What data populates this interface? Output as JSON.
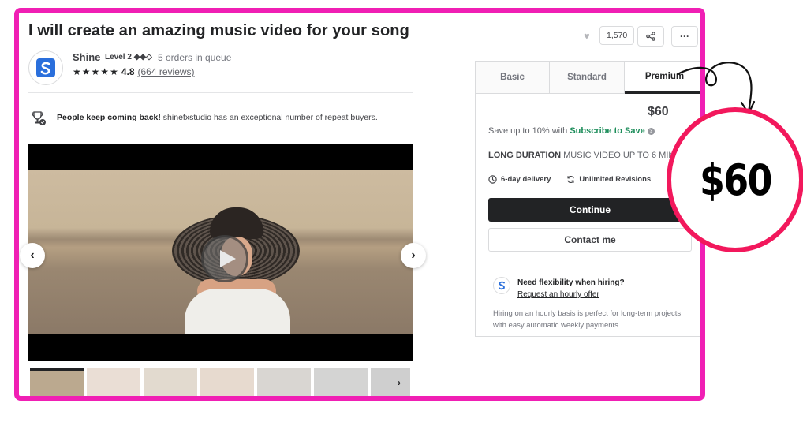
{
  "gig": {
    "title": "I will create an amazing music video for your song",
    "seller_name": "Shine",
    "seller_level": "Level 2 ◆◆◇",
    "orders_in_queue": "5 orders in queue",
    "rating": "4.8",
    "reviews": "(664 reviews)",
    "repeat_bold": "People keep coming back!",
    "repeat_text": " shinefxstudio has an exceptional number of repeat buyers."
  },
  "actions": {
    "likes": "1,570",
    "more": "···"
  },
  "package": {
    "tabs": [
      "Basic",
      "Standard",
      "Premium"
    ],
    "active_tab": "Premium",
    "price": "$60",
    "save_prefix": "Save up to 10% with ",
    "save_link": "Subscribe to Save",
    "desc_bold": "LONG DURATION",
    "desc_rest": " MUSIC VIDEO UP TO 6 MIN",
    "delivery": "6-day delivery",
    "revisions": "Unlimited Revisions",
    "continue": "Continue",
    "contact": "Contact me",
    "hourly_title": "Need flexibility when hiring?",
    "hourly_link": "Request an hourly offer",
    "hourly_desc": "Hiring on an hourly basis is perfect for long-term projects, with easy automatic weekly payments."
  },
  "callout": {
    "text": "$60"
  },
  "colors": {
    "frame": "#f01fb4",
    "callout_ring": "#f2185c",
    "save_link": "#1c8d5a"
  }
}
